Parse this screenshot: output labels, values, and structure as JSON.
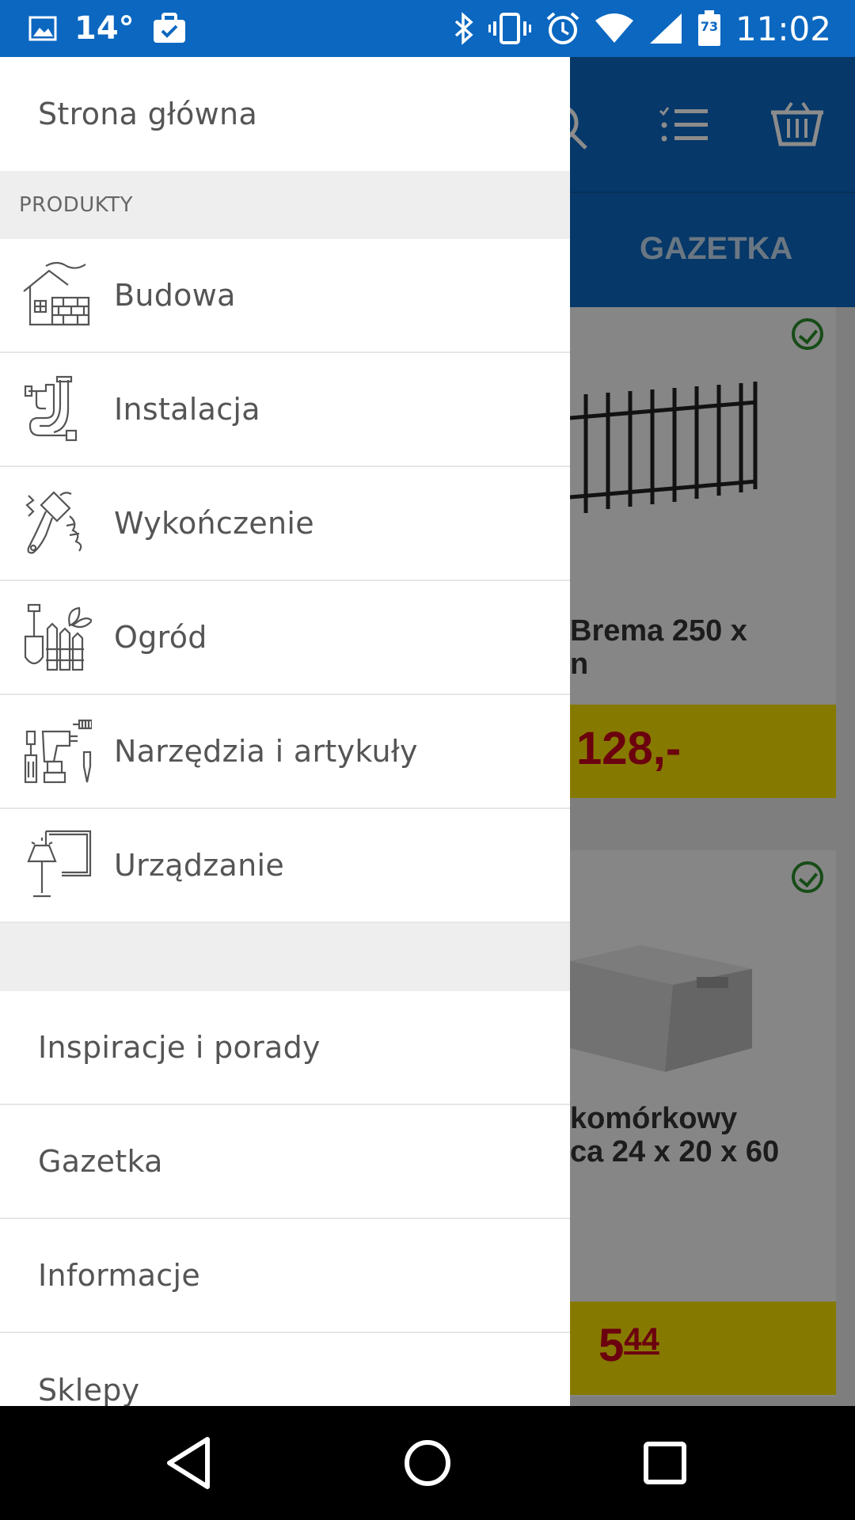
{
  "status_bar": {
    "temperature": "14°",
    "time": "11:02",
    "battery_level": "73"
  },
  "app_background": {
    "tab_label": "GAZETKA",
    "cards": [
      {
        "title": "Brema 250 x\nn",
        "price": "128,-"
      },
      {
        "title": "komórkowy\nca 24 x 20 x 60",
        "price_main": "5",
        "price_cents": "44"
      }
    ]
  },
  "drawer": {
    "home": "Strona główna",
    "section_header": "PRODUKTY",
    "categories": [
      {
        "label": "Budowa",
        "icon": "house-bricks-icon"
      },
      {
        "label": "Instalacja",
        "icon": "pipes-icon"
      },
      {
        "label": "Wykończenie",
        "icon": "paint-brush-icon"
      },
      {
        "label": "Ogród",
        "icon": "garden-tools-icon"
      },
      {
        "label": "Narzędzia i artykuły",
        "icon": "tools-icon"
      },
      {
        "label": "Urządzanie",
        "icon": "lamp-picture-icon"
      }
    ],
    "links": [
      {
        "label": "Inspiracje i porady"
      },
      {
        "label": "Gazetka"
      },
      {
        "label": "Informacje"
      },
      {
        "label": "Sklepy"
      }
    ]
  },
  "colors": {
    "brand_blue": "#0b67c0",
    "price_yellow": "#f4dd00",
    "price_red": "#c4001a",
    "check_green": "#2a8a2a"
  }
}
